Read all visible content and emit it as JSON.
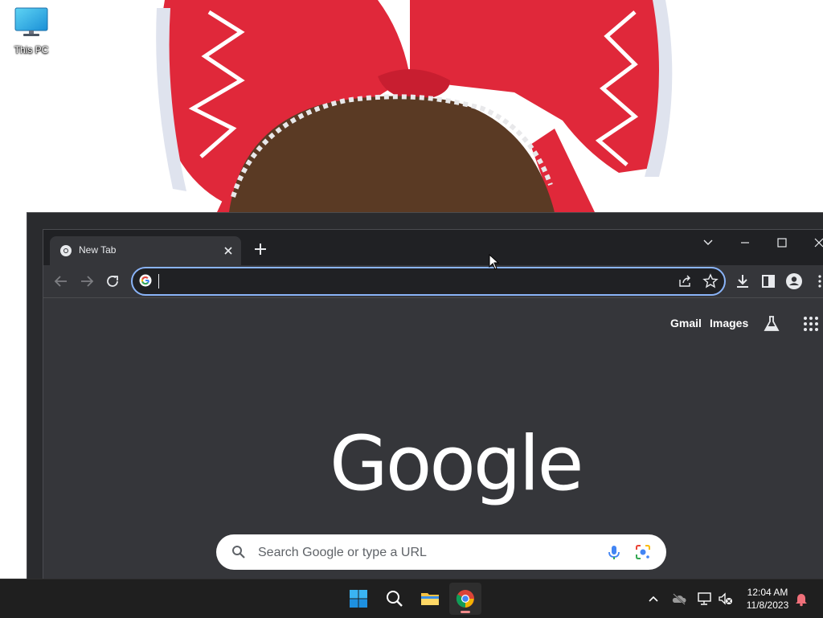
{
  "desktop": {
    "icons": [
      {
        "label": "This PC",
        "icon": "monitor-icon"
      }
    ]
  },
  "browser": {
    "tab": {
      "title": "New Tab",
      "icon": "chrome-icon"
    },
    "omnibox": {
      "value": "",
      "placeholder": ""
    },
    "ntp": {
      "links": {
        "gmail": "Gmail",
        "images": "Images"
      },
      "logo": "Google",
      "search_placeholder": "Search Google or type a URL"
    }
  },
  "taskbar": {
    "apps": [
      "start-icon",
      "search-icon",
      "file-explorer-icon",
      "chrome-icon"
    ],
    "clock": {
      "time": "12:04 AM",
      "date": "11/8/2023"
    }
  },
  "colors": {
    "accent": "#8ab4f8",
    "chrome_dark": "#35363a",
    "tabstrip": "#202124",
    "wallpaper_bow": "#e0283a"
  }
}
